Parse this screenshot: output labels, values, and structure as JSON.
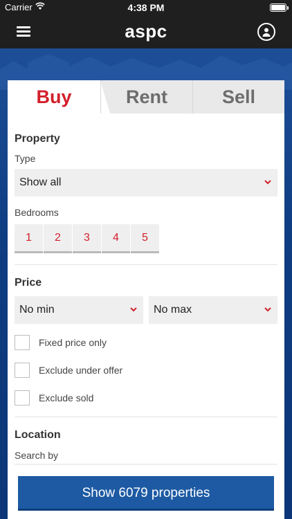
{
  "status_bar": {
    "carrier": "Carrier",
    "time": "4:38 PM"
  },
  "header": {
    "logo": "aspc",
    "menu_icon": "hamburger-menu-icon",
    "profile_icon": "user-profile-icon"
  },
  "tabs": [
    {
      "label": "Buy",
      "active": true
    },
    {
      "label": "Rent",
      "active": false
    },
    {
      "label": "Sell",
      "active": false
    }
  ],
  "property": {
    "title": "Property",
    "type_label": "Type",
    "type_value": "Show all",
    "bedrooms_label": "Bedrooms",
    "bedrooms": [
      "1",
      "2",
      "3",
      "4",
      "5"
    ]
  },
  "price": {
    "title": "Price",
    "min_value": "No min",
    "max_value": "No max",
    "options": [
      {
        "label": "Fixed price only",
        "checked": false
      },
      {
        "label": "Exclude under offer",
        "checked": false
      },
      {
        "label": "Exclude sold",
        "checked": false
      }
    ]
  },
  "location": {
    "title": "Location",
    "search_by_label": "Search by"
  },
  "footer": {
    "show_button": "Show 6079 properties"
  },
  "colors": {
    "accent_red": "#d21f2b",
    "primary_blue": "#1d5aa3",
    "header_dark": "#1f1f1f"
  }
}
